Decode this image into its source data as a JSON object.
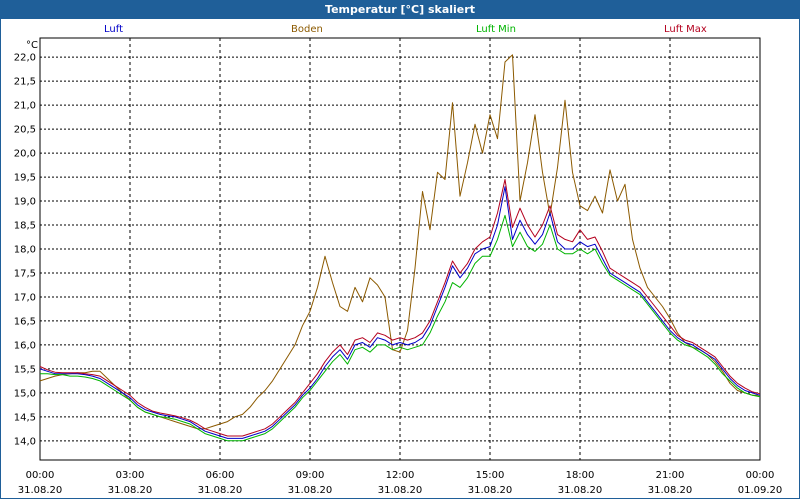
{
  "window": {
    "title": "Temperatur [°C] skaliert"
  },
  "chart_data": {
    "type": "line",
    "title": "Temperatur [°C] skaliert",
    "ylabel": "°C",
    "xlabel": "",
    "ylim": [
      13.6,
      22.4
    ],
    "y_ticks": [
      "14,0",
      "14,5",
      "15,0",
      "15,5",
      "16,0",
      "16,5",
      "17,0",
      "17,5",
      "18,0",
      "18,5",
      "19,0",
      "19,5",
      "20,0",
      "20,5",
      "21,0",
      "21,5",
      "22,0"
    ],
    "x_ticks": [
      {
        "time": "00:00",
        "date": "31.08.20"
      },
      {
        "time": "03:00",
        "date": "31.08.20"
      },
      {
        "time": "06:00",
        "date": "31.08.20"
      },
      {
        "time": "09:00",
        "date": "31.08.20"
      },
      {
        "time": "12:00",
        "date": "31.08.20"
      },
      {
        "time": "15:00",
        "date": "31.08.20"
      },
      {
        "time": "18:00",
        "date": "31.08.20"
      },
      {
        "time": "21:00",
        "date": "31.08.20"
      },
      {
        "time": "00:00",
        "date": "01.09.20"
      }
    ],
    "x_hours": [
      0,
      0.25,
      0.5,
      0.75,
      1,
      1.25,
      1.5,
      1.75,
      2,
      2.25,
      2.5,
      2.75,
      3,
      3.25,
      3.5,
      3.75,
      4,
      4.25,
      4.5,
      4.75,
      5,
      5.25,
      5.5,
      5.75,
      6,
      6.25,
      6.5,
      6.75,
      7,
      7.25,
      7.5,
      7.75,
      8,
      8.25,
      8.5,
      8.75,
      9,
      9.25,
      9.5,
      9.75,
      10,
      10.25,
      10.5,
      10.75,
      11,
      11.25,
      11.5,
      11.75,
      12,
      12.25,
      12.5,
      12.75,
      13,
      13.25,
      13.5,
      13.75,
      14,
      14.25,
      14.5,
      14.75,
      15,
      15.25,
      15.5,
      15.75,
      16,
      16.25,
      16.5,
      16.75,
      17,
      17.25,
      17.5,
      17.75,
      18,
      18.25,
      18.5,
      18.75,
      19,
      19.25,
      19.5,
      19.75,
      20,
      20.25,
      20.5,
      20.75,
      21,
      21.25,
      21.5,
      21.75,
      22,
      22.25,
      22.5,
      22.75,
      23,
      23.25,
      23.5,
      23.75,
      24
    ],
    "series": [
      {
        "name": "Luft",
        "color": "#0000c8",
        "values": [
          15.5,
          15.45,
          15.4,
          15.4,
          15.4,
          15.4,
          15.38,
          15.35,
          15.3,
          15.2,
          15.1,
          15.0,
          14.9,
          14.75,
          14.65,
          14.6,
          14.55,
          14.52,
          14.5,
          14.45,
          14.4,
          14.3,
          14.2,
          14.15,
          14.1,
          14.05,
          14.05,
          14.05,
          14.1,
          14.15,
          14.2,
          14.3,
          14.45,
          14.6,
          14.75,
          14.95,
          15.1,
          15.3,
          15.55,
          15.75,
          15.9,
          15.7,
          16.0,
          16.05,
          15.95,
          16.15,
          16.1,
          16.0,
          16.05,
          16.0,
          16.05,
          16.15,
          16.4,
          16.8,
          17.2,
          17.65,
          17.4,
          17.6,
          17.9,
          18.0,
          18.05,
          18.5,
          19.3,
          18.2,
          18.6,
          18.3,
          18.1,
          18.3,
          18.75,
          18.15,
          18.0,
          18.0,
          18.15,
          18.05,
          18.1,
          17.8,
          17.5,
          17.4,
          17.3,
          17.2,
          17.1,
          16.9,
          16.7,
          16.5,
          16.3,
          16.15,
          16.05,
          16.0,
          15.9,
          15.8,
          15.7,
          15.5,
          15.3,
          15.15,
          15.05,
          15.0,
          14.95
        ]
      },
      {
        "name": "Boden",
        "color": "#8c5a00",
        "values": [
          15.25,
          15.3,
          15.35,
          15.38,
          15.4,
          15.42,
          15.42,
          15.45,
          15.45,
          15.3,
          15.15,
          15.0,
          14.85,
          14.7,
          14.6,
          14.55,
          14.5,
          14.45,
          14.4,
          14.35,
          14.3,
          14.25,
          14.25,
          14.3,
          14.35,
          14.4,
          14.5,
          14.55,
          14.7,
          14.9,
          15.05,
          15.25,
          15.5,
          15.75,
          16.0,
          16.4,
          16.7,
          17.2,
          17.85,
          17.3,
          16.8,
          16.7,
          17.2,
          16.9,
          17.4,
          17.25,
          17.0,
          15.9,
          15.85,
          16.3,
          17.6,
          19.2,
          18.4,
          19.6,
          19.45,
          21.05,
          19.1,
          19.8,
          20.6,
          20.0,
          20.8,
          20.3,
          21.9,
          22.05,
          19.0,
          19.8,
          20.8,
          19.6,
          18.7,
          19.7,
          21.1,
          19.6,
          18.9,
          18.8,
          19.1,
          18.75,
          19.65,
          19.0,
          19.35,
          18.2,
          17.6,
          17.2,
          17.0,
          16.8,
          16.55,
          16.25,
          16.05,
          15.95,
          15.9,
          15.8,
          15.65,
          15.45,
          15.2,
          15.05,
          15.0,
          14.95,
          14.95
        ]
      },
      {
        "name": "Luft Min",
        "color": "#00b400",
        "values": [
          15.4,
          15.4,
          15.38,
          15.38,
          15.35,
          15.35,
          15.33,
          15.3,
          15.25,
          15.15,
          15.05,
          14.95,
          14.85,
          14.7,
          14.6,
          14.55,
          14.5,
          14.48,
          14.45,
          14.4,
          14.35,
          14.25,
          14.15,
          14.1,
          14.05,
          14.0,
          14.0,
          14.0,
          14.05,
          14.1,
          14.15,
          14.25,
          14.4,
          14.55,
          14.7,
          14.9,
          15.05,
          15.25,
          15.45,
          15.65,
          15.8,
          15.6,
          15.9,
          15.95,
          15.85,
          16.0,
          16.0,
          15.9,
          15.95,
          15.9,
          15.95,
          16.0,
          16.25,
          16.6,
          16.9,
          17.3,
          17.2,
          17.4,
          17.7,
          17.85,
          17.85,
          18.2,
          18.7,
          18.05,
          18.35,
          18.05,
          17.95,
          18.1,
          18.5,
          18.0,
          17.9,
          17.9,
          18.0,
          17.9,
          18.0,
          17.7,
          17.45,
          17.35,
          17.25,
          17.15,
          17.05,
          16.85,
          16.65,
          16.45,
          16.25,
          16.1,
          16.0,
          15.95,
          15.85,
          15.75,
          15.6,
          15.4,
          15.25,
          15.1,
          15.0,
          14.95,
          14.92
        ]
      },
      {
        "name": "Luft Max",
        "color": "#b4001e",
        "values": [
          15.55,
          15.48,
          15.43,
          15.42,
          15.42,
          15.42,
          15.4,
          15.38,
          15.35,
          15.25,
          15.15,
          15.05,
          14.95,
          14.8,
          14.7,
          14.62,
          14.58,
          14.55,
          14.52,
          14.48,
          14.43,
          14.35,
          14.25,
          14.2,
          14.15,
          14.1,
          14.1,
          14.1,
          14.15,
          14.2,
          14.25,
          14.35,
          14.5,
          14.65,
          14.8,
          15.0,
          15.2,
          15.4,
          15.65,
          15.85,
          16.0,
          15.8,
          16.1,
          16.15,
          16.05,
          16.25,
          16.2,
          16.1,
          16.15,
          16.1,
          16.15,
          16.25,
          16.5,
          16.9,
          17.3,
          17.75,
          17.5,
          17.7,
          18.0,
          18.15,
          18.25,
          18.75,
          19.45,
          18.45,
          18.85,
          18.5,
          18.25,
          18.5,
          18.9,
          18.3,
          18.2,
          18.15,
          18.4,
          18.2,
          18.25,
          17.95,
          17.6,
          17.5,
          17.4,
          17.3,
          17.2,
          17.0,
          16.8,
          16.6,
          16.4,
          16.2,
          16.1,
          16.05,
          15.95,
          15.85,
          15.75,
          15.55,
          15.35,
          15.2,
          15.1,
          15.02,
          14.98
        ]
      }
    ]
  }
}
